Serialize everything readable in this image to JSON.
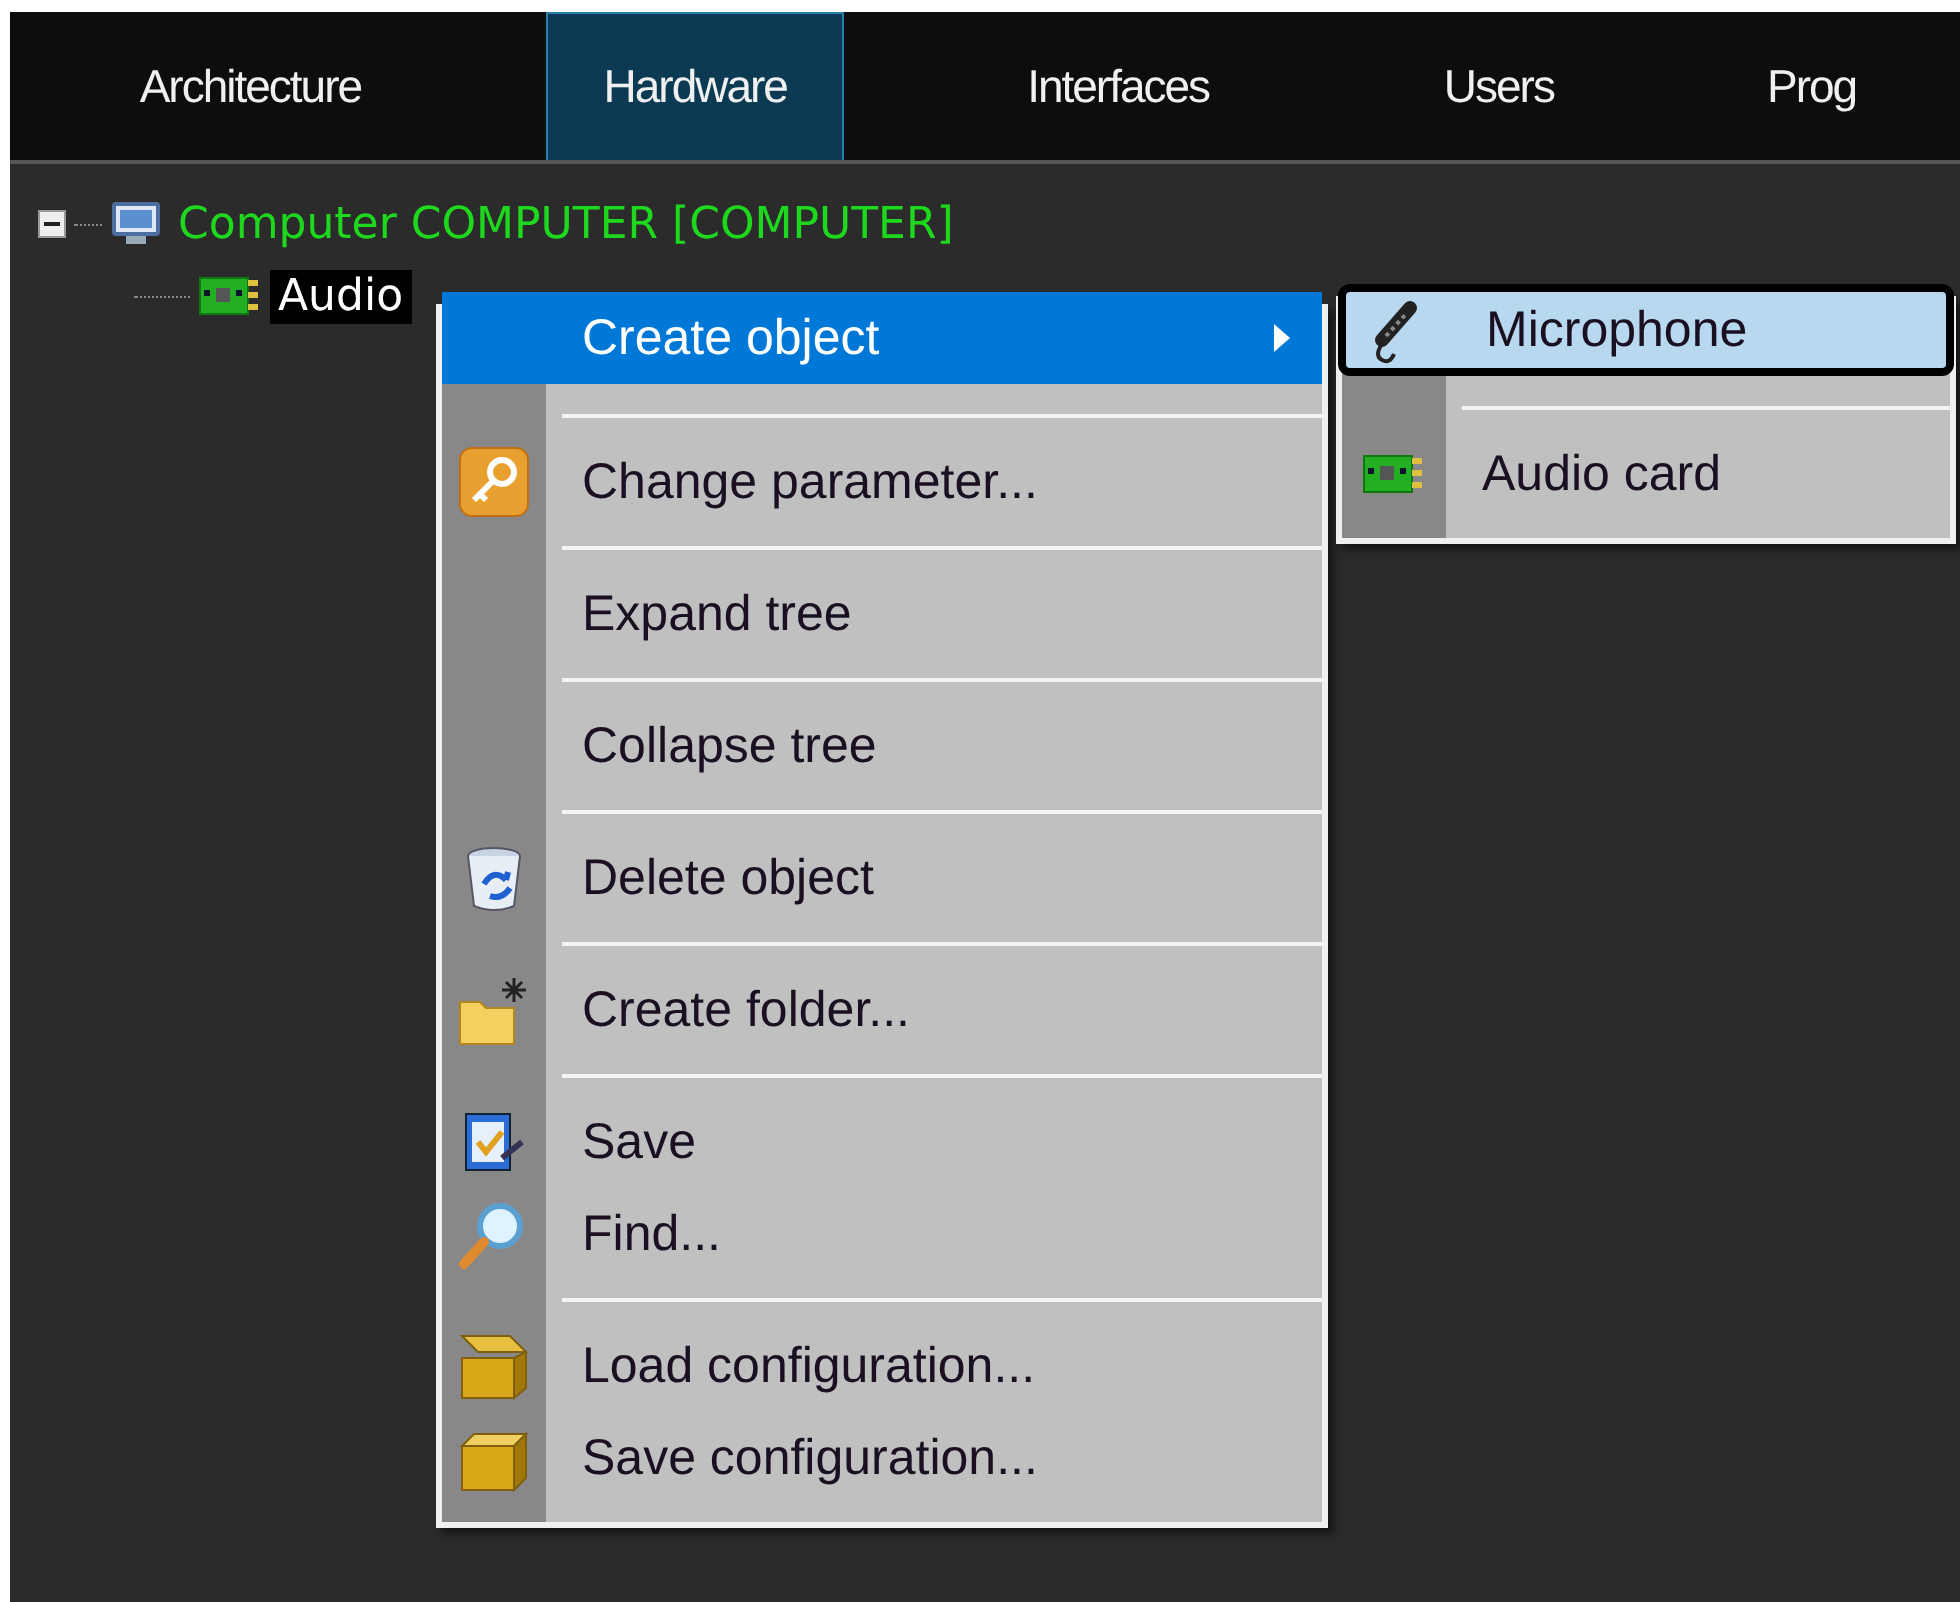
{
  "tabs": [
    {
      "label": "Architecture",
      "selected": false
    },
    {
      "label": "Hardware",
      "selected": true
    },
    {
      "label": "Interfaces",
      "selected": false
    },
    {
      "label": "Users",
      "selected": false
    },
    {
      "label": "Prog",
      "selected": false
    }
  ],
  "tree": [
    {
      "label": "Computer COMPUTER [COMPUTER]",
      "expanded": true,
      "selected": false,
      "children": [
        {
          "label": "Audio",
          "selected": true
        }
      ]
    }
  ],
  "context_menu": {
    "groups": [
      [
        {
          "label": "Create object",
          "selected": true,
          "has_submenu": true
        }
      ],
      [
        {
          "label": "Change parameter...",
          "selected": false,
          "has_submenu": false
        }
      ],
      [
        {
          "label": "Expand tree",
          "selected": false,
          "has_submenu": false
        }
      ],
      [
        {
          "label": "Collapse tree",
          "selected": false,
          "has_submenu": false
        }
      ],
      [
        {
          "label": "Delete object",
          "selected": false,
          "has_submenu": false
        }
      ],
      [
        {
          "label": "Create folder...",
          "selected": false,
          "has_submenu": false
        }
      ],
      [
        {
          "label": "Save",
          "selected": false,
          "has_submenu": false
        },
        {
          "label": "Find...",
          "selected": false,
          "has_submenu": false
        }
      ],
      [
        {
          "label": "Load configuration...",
          "selected": false,
          "has_submenu": false
        },
        {
          "label": "Save configuration...",
          "selected": false,
          "has_submenu": false
        }
      ]
    ]
  },
  "submenu": {
    "groups": [
      [
        {
          "label": "Microphone",
          "selected": true
        }
      ],
      [
        {
          "label": "Audio card",
          "selected": false
        }
      ]
    ]
  }
}
